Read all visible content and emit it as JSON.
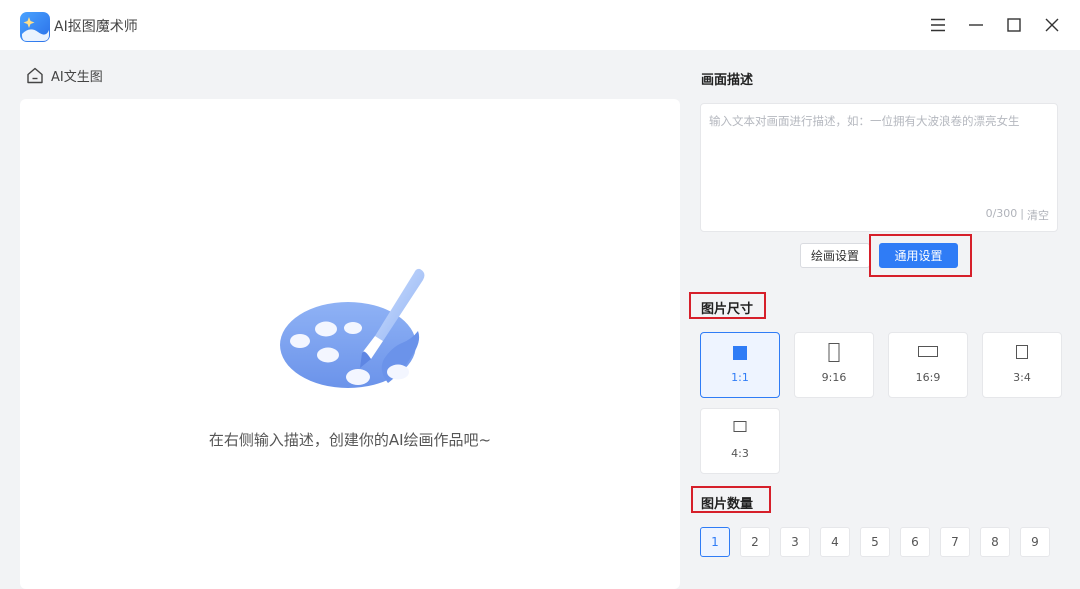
{
  "window": {
    "title": "AI抠图魔术师",
    "controls": [
      "menu-icon",
      "minimize-icon",
      "maximize-icon",
      "close-icon"
    ]
  },
  "breadcrumb": {
    "icon": "home-icon",
    "label": "AI文生图"
  },
  "canvas": {
    "illustration": "palette-brush-icon",
    "hint": "在右侧输入描述，创建你的AI绘画作品吧~"
  },
  "description": {
    "title": "画面描述",
    "placeholder": "输入文本对画面进行描述，如：一位拥有大波浪卷的漂亮女生",
    "value": "",
    "counter": "0/300",
    "separator": "|",
    "clear_label": "清空"
  },
  "settings_tabs": {
    "draw_label": "绘画设置",
    "general_label": "通用设置",
    "active": "通用设置"
  },
  "image_size": {
    "title": "图片尺寸",
    "options": [
      {
        "label": "1:1",
        "selected": true
      },
      {
        "label": "9:16",
        "selected": false
      },
      {
        "label": "16:9",
        "selected": false
      },
      {
        "label": "3:4",
        "selected": false
      },
      {
        "label": "4:3",
        "selected": false
      }
    ]
  },
  "image_count": {
    "title": "图片数量",
    "options": [
      "1",
      "2",
      "3",
      "4",
      "5",
      "6",
      "7",
      "8",
      "9"
    ],
    "selected": "1"
  },
  "colors": {
    "accent": "#2f7cf6",
    "highlight": "#d61f2a",
    "background": "#f2f3f5"
  }
}
